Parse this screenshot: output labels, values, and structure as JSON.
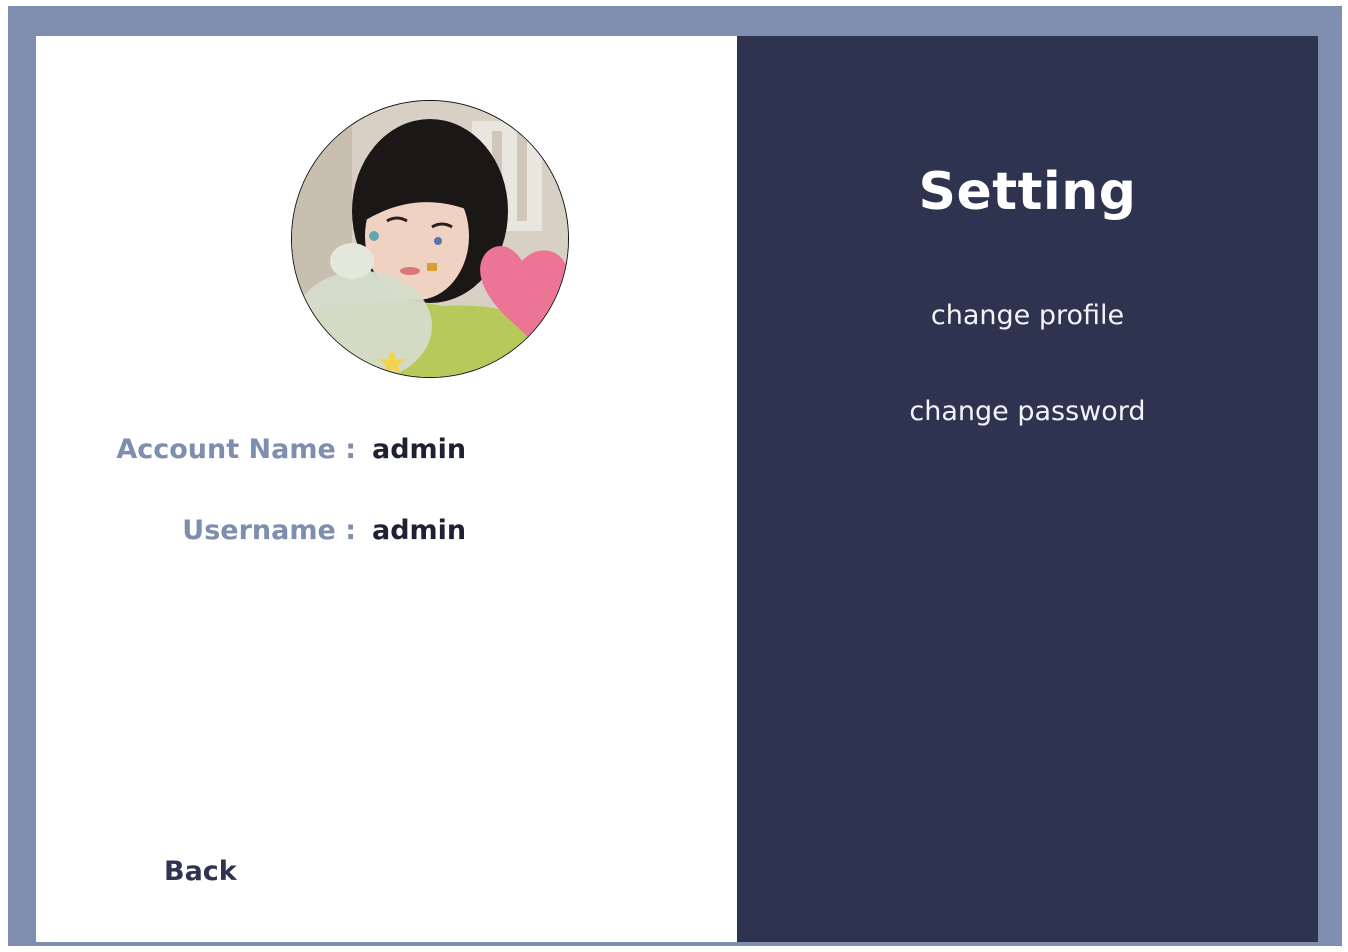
{
  "profile": {
    "account_name_label": "Account Name :",
    "account_name_value": "admin",
    "username_label": "Username :",
    "username_value": "admin",
    "back_label": "Back"
  },
  "settings": {
    "title": "Setting",
    "menu": [
      {
        "label": "change profile"
      },
      {
        "label": "change password"
      }
    ]
  },
  "colors": {
    "frame": "#7f8dae",
    "panel": "#2e3450",
    "label": "#7f8dae"
  }
}
